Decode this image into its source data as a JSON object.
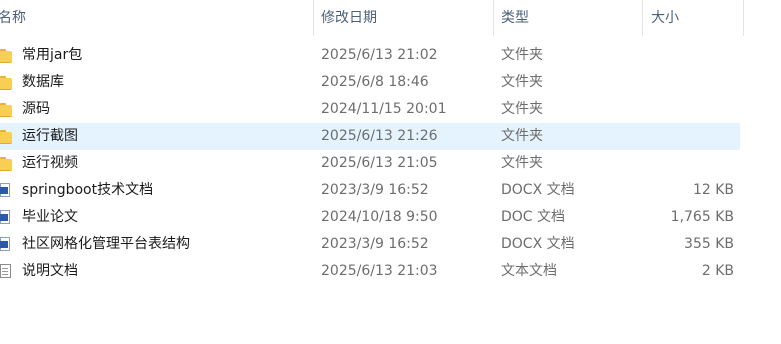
{
  "columns": {
    "name": "名称",
    "date": "修改日期",
    "type": "类型",
    "size": "大小"
  },
  "sort_indicator": "^",
  "files": [
    {
      "name": "常用jar包",
      "date": "2025/6/13 21:02",
      "type": "文件夹",
      "size": "",
      "icon": "folder-icon"
    },
    {
      "name": "数据库",
      "date": "2025/6/8 18:46",
      "type": "文件夹",
      "size": "",
      "icon": "folder-icon"
    },
    {
      "name": "源码",
      "date": "2024/11/15 20:01",
      "type": "文件夹",
      "size": "",
      "icon": "folder-icon"
    },
    {
      "name": "运行截图",
      "date": "2025/6/13 21:26",
      "type": "文件夹",
      "size": "",
      "icon": "folder-icon",
      "selected": true
    },
    {
      "name": "运行视频",
      "date": "2025/6/13 21:05",
      "type": "文件夹",
      "size": "",
      "icon": "folder-icon"
    },
    {
      "name": "springboot技术文档",
      "date": "2023/3/9 16:52",
      "type": "DOCX 文档",
      "size": "12 KB",
      "icon": "word-doc-icon"
    },
    {
      "name": "毕业论文",
      "date": "2024/10/18 9:50",
      "type": "DOC 文档",
      "size": "1,765 KB",
      "icon": "word-doc-icon"
    },
    {
      "name": "社区网格化管理平台表结构",
      "date": "2023/3/9 16:52",
      "type": "DOCX 文档",
      "size": "355 KB",
      "icon": "word-doc-icon"
    },
    {
      "name": "说明文档",
      "date": "2025/6/13 21:03",
      "type": "文本文档",
      "size": "2 KB",
      "icon": "text-file-icon"
    }
  ]
}
